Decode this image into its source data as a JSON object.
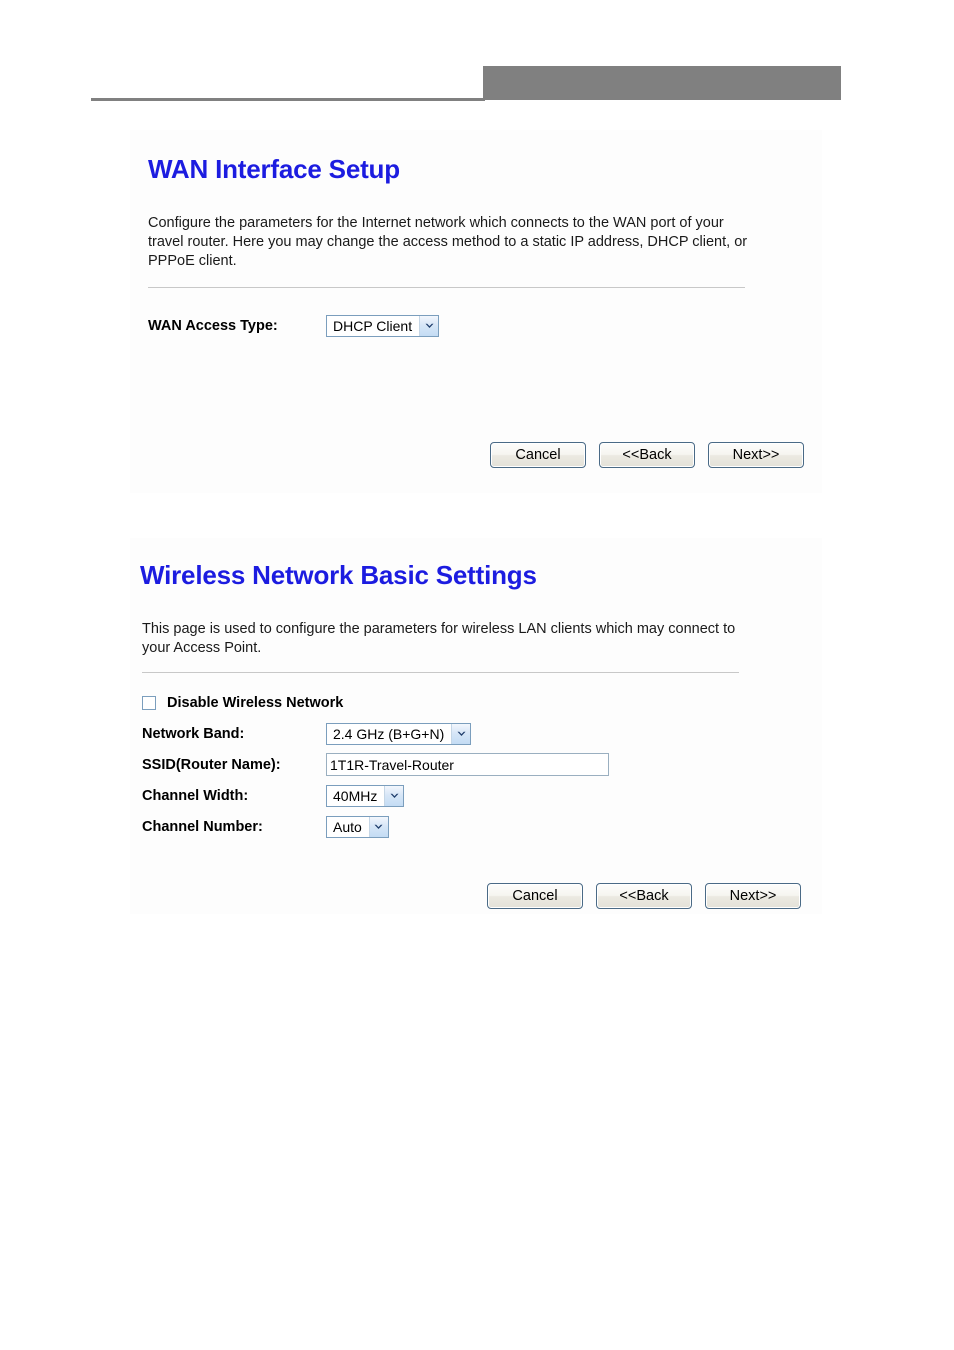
{
  "header": {
    "gray_block": "decorative-gray-block",
    "rule": "decorative-rule",
    "accent_color": "#808080"
  },
  "theme": {
    "heading_color": "#1c1ce0",
    "text_color": "#1a1a1a",
    "panel_background": "#fdfdfd",
    "select_border": "#7b9ebd"
  },
  "panels": [
    {
      "id": "wan-interface-setup",
      "title": "WAN Interface Setup",
      "description": "Configure the parameters for the Internet network which connects to the WAN port of your travel router. Here you may change the access method to a static IP address, DHCP client, or PPPoE client.",
      "fields": {
        "wan_access_type": {
          "label": "WAN Access Type:",
          "value": "DHCP Client"
        }
      },
      "buttons": {
        "cancel": "Cancel",
        "back": "<<Back",
        "next": "Next>>"
      }
    },
    {
      "id": "wireless-network-basic-settings",
      "title": "Wireless Network Basic Settings",
      "description": "This page is used to configure the parameters for wireless LAN clients which may connect to your Access Point.",
      "fields": {
        "disable_wireless": {
          "label": "Disable Wireless Network",
          "checked": false
        },
        "network_band": {
          "label": "Network Band:",
          "value": "2.4 GHz (B+G+N)"
        },
        "ssid": {
          "label": "SSID(Router Name):",
          "value": "1T1R-Travel-Router"
        },
        "channel_width": {
          "label": "Channel Width:",
          "value": "40MHz"
        },
        "channel_number": {
          "label": "Channel Number:",
          "value": "Auto"
        }
      },
      "buttons": {
        "cancel": "Cancel",
        "back": "<<Back",
        "next": "Next>>"
      }
    }
  ]
}
